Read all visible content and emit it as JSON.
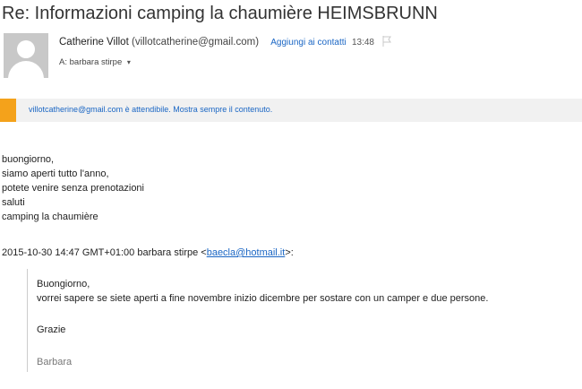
{
  "email": {
    "subject": "Re: Informazioni camping la chaumière HEIMSBRUNN",
    "sender": {
      "name": "Catherine Villot",
      "email": "(villotcatherine@gmail.com)",
      "add_contact": "Aggiungi ai contatti",
      "time": "13:48",
      "to_label": "A:",
      "to_name": "barbara stirpe"
    },
    "banner": "villotcatherine@gmail.com è attendibile. Mostra sempre il contenuto.",
    "body_lines": [
      "buongiorno,",
      "siamo aperti tutto l'anno,",
      "potete venire senza prenotazioni",
      "saluti",
      "camping la chaumière"
    ],
    "quote_header": {
      "prefix": "2015-10-30 14:47 GMT+01:00 barbara stirpe <",
      "link": "baecla@hotmail.it",
      "suffix": ">:"
    },
    "quote": {
      "greeting": "Buongiorno,",
      "text": "vorrei sapere se siete aperti a fine novembre inizio dicembre per sostare con un camper e due persone.",
      "thanks": "Grazie",
      "signature": "Barbara"
    }
  },
  "icons": {
    "avatar": "person-avatar",
    "flag": "flag-icon",
    "expand": "chevron-down-icon"
  },
  "colors": {
    "link": "#1a66c4",
    "banner_accent": "#f4a21b",
    "banner_bg": "#f1f1f1"
  }
}
